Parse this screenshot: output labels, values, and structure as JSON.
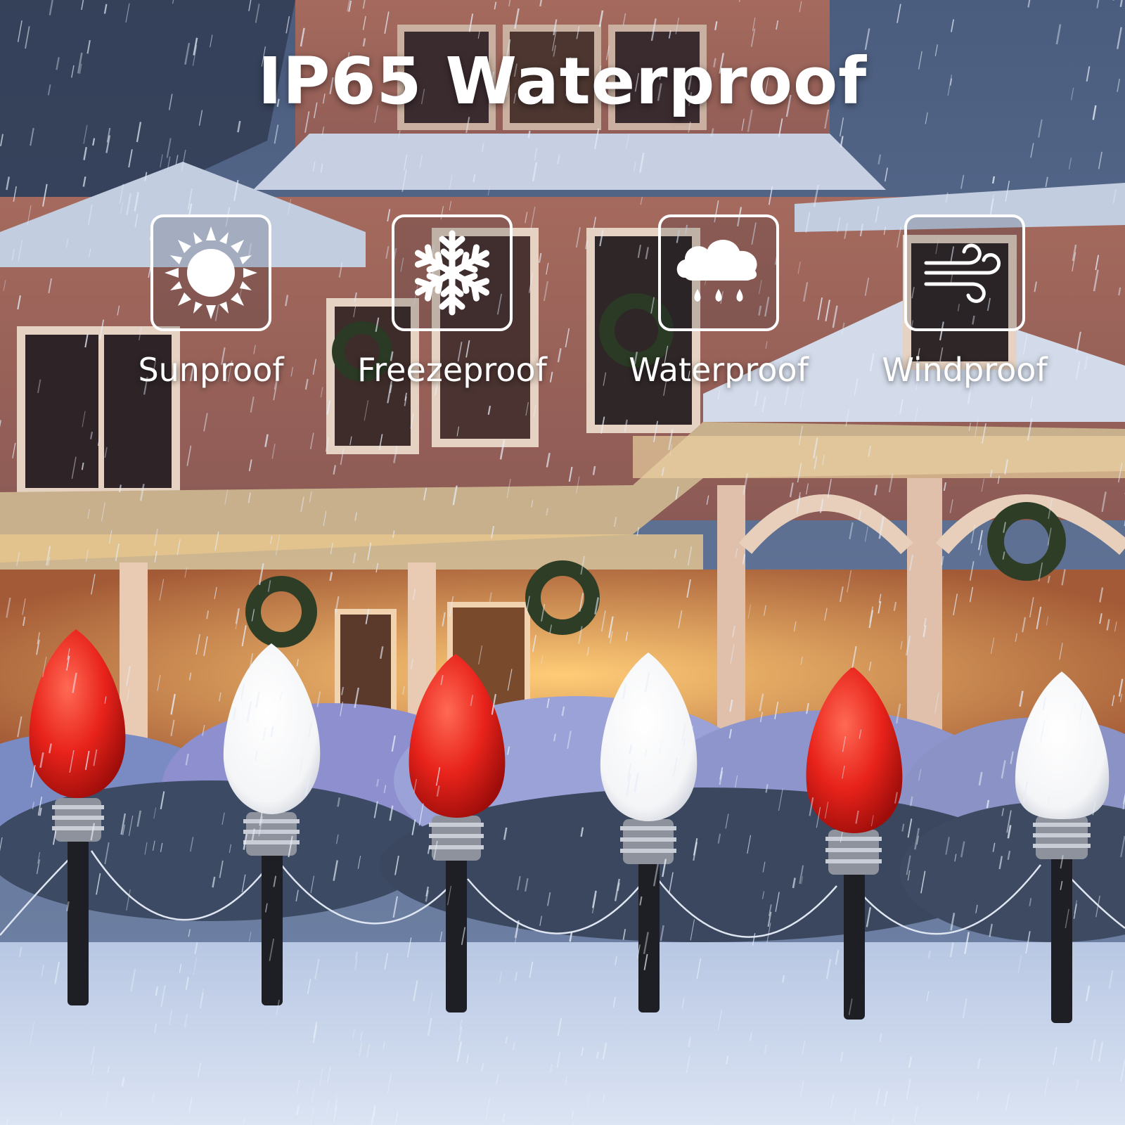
{
  "headline": "IP65 Waterproof",
  "features": [
    {
      "label": "Sunproof",
      "icon": "sun-icon"
    },
    {
      "label": "Freezeproof",
      "icon": "snowflake-icon"
    },
    {
      "label": "Waterproof",
      "icon": "rain-cloud-icon"
    },
    {
      "label": "Windproof",
      "icon": "wind-icon"
    }
  ],
  "colors": {
    "text": "#ffffff",
    "bulb_red": "#e8231b",
    "bulb_white": "#ffffff",
    "house": "#b9735c",
    "snow": "#c9d6ec",
    "warm_light": "#f2b45a"
  }
}
